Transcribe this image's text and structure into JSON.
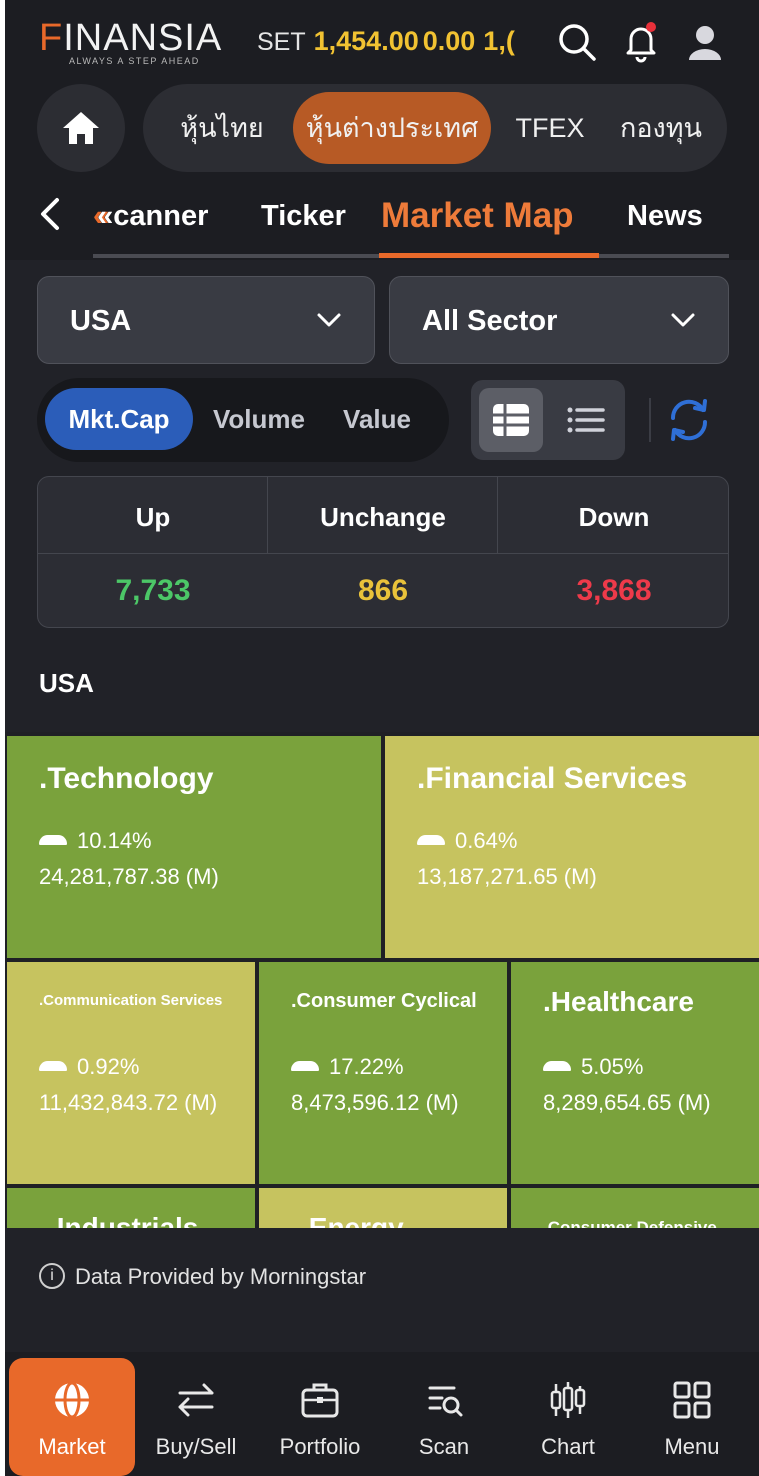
{
  "header": {
    "logo_text": "FINANSIA",
    "logo_tagline": "ALWAYS A STEP AHEAD",
    "ticker_label": "SET",
    "ticker_value": "1,454.00",
    "ticker_change": "0.00",
    "ticker_extra": "1,("
  },
  "categories": [
    "หุ้นไทย",
    "หุ้นต่างประเทศ",
    "TFEX",
    "กองทุน"
  ],
  "category_active": "หุ้นต่างประเทศ",
  "subtabs": [
    "«canner",
    "Ticker",
    "Market Map",
    "News"
  ],
  "subtab_active": "Market Map",
  "filters": {
    "country": "USA",
    "sector": "All Sector"
  },
  "segments": [
    "Mkt.Cap",
    "Volume",
    "Value"
  ],
  "segment_active": "Mkt.Cap",
  "stats": {
    "up_label": "Up",
    "unchange_label": "Unchange",
    "down_label": "Down",
    "up_value": "7,733",
    "unchange_value": "866",
    "down_value": "3,868",
    "up_color": "#4cc767",
    "unchange_color": "#e9c23a",
    "down_color": "#ee3a4a"
  },
  "market_title": "USA",
  "treemap": [
    {
      "name": ".Technology",
      "pct": "10.14%",
      "value": "24,281,787.38 (M)",
      "color": "#7aa23c"
    },
    {
      "name": ".Financial Services",
      "pct": "0.64%",
      "value": "13,187,271.65 (M)",
      "color": "#c6c35f"
    },
    {
      "name": ".Communication Services",
      "pct": "0.92%",
      "value": "11,432,843.72 (M)",
      "color": "#c6c35f"
    },
    {
      "name": ".Consumer Cyclical",
      "pct": "17.22%",
      "value": "8,473,596.12 (M)",
      "color": "#7aa23c"
    },
    {
      "name": ".Healthcare",
      "pct": "5.05%",
      "value": "8,289,654.65 (M)",
      "color": "#7aa23c"
    },
    {
      "name": ".Industrials",
      "color": "#7aa23c"
    },
    {
      "name": ".Energy",
      "color": "#c6c35f"
    },
    {
      "name": ".Consumer Defensive",
      "color": "#7aa23c"
    }
  ],
  "provider_text": "Data Provided by Morningstar",
  "bottom_nav": [
    "Market",
    "Buy/Sell",
    "Portfolio",
    "Scan",
    "Chart",
    "Menu"
  ],
  "bottom_nav_active": "Market",
  "accent_color": "#e8692a"
}
